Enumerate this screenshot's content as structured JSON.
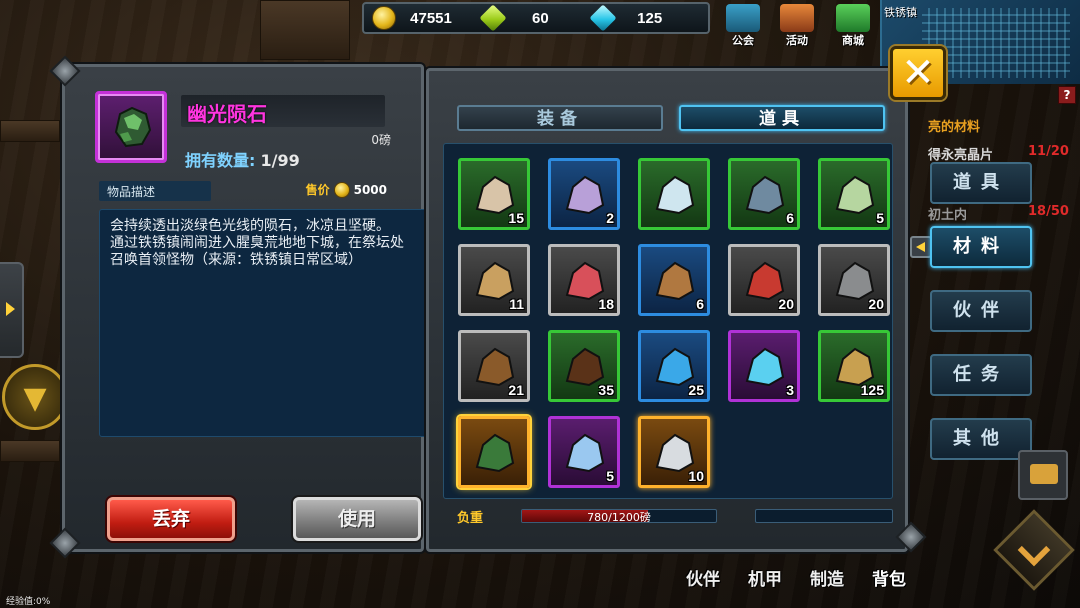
{
  "currency": [
    {
      "icon": "gold-coin-icon",
      "value": "47551"
    },
    {
      "icon": "green-gem-icon",
      "value": "60"
    },
    {
      "icon": "blue-diamond-icon",
      "value": "125"
    }
  ],
  "top_menu": [
    {
      "label": "公会",
      "icon": "guild-icon"
    },
    {
      "label": "活动",
      "icon": "event-icon"
    },
    {
      "label": "商城",
      "icon": "shop-cart-icon"
    }
  ],
  "minimap": {
    "title": "铁锈镇"
  },
  "help": "?",
  "quest_behind": {
    "line1": "亮的材料",
    "line2_left": "得永亮晶片",
    "line2_right": "11/20",
    "line3_left": "初土内",
    "line3_right": "18/50"
  },
  "detail": {
    "name": "幽光陨石",
    "weight": "0磅",
    "owned_label": "拥有数量:",
    "owned_value": "1/99",
    "desc_label": "物品描述",
    "price_label": "售价",
    "price_value": "5000",
    "description": "会持续透出淡绿色光线的陨石，冰凉且坚硬。\n通过铁锈镇闹闹进入腥臭荒地地下城，在祭坛处召唤首领怪物（来源：铁锈镇日常区域）",
    "discard_label": "丢弃",
    "use_label": "使用"
  },
  "tabs": {
    "equip": "装备",
    "items": "道具",
    "active": "items"
  },
  "inventory": [
    {
      "name": "sand-pile",
      "rarity": "green",
      "count": "15",
      "color": "#d8c4a8"
    },
    {
      "name": "purple-powder",
      "rarity": "blue",
      "count": "2",
      "color": "#b8a0d8"
    },
    {
      "name": "test-tube",
      "rarity": "green",
      "count": "",
      "color": "#cfe6ef"
    },
    {
      "name": "iron-clamp",
      "rarity": "green",
      "count": "6",
      "color": "#6f8aa0"
    },
    {
      "name": "green-powder",
      "rarity": "green",
      "count": "5",
      "color": "#b6d6a0"
    },
    {
      "name": "potato",
      "rarity": "white",
      "count": "11",
      "color": "#c9a060"
    },
    {
      "name": "raw-meat",
      "rarity": "white",
      "count": "18",
      "color": "#d8505a"
    },
    {
      "name": "mushrooms",
      "rarity": "blue",
      "count": "6",
      "color": "#b07840"
    },
    {
      "name": "red-fang",
      "rarity": "white",
      "count": "20",
      "color": "#c83a30"
    },
    {
      "name": "iron-scrap",
      "rarity": "white",
      "count": "20",
      "color": "#8a8c8e"
    },
    {
      "name": "leather-hide",
      "rarity": "white",
      "count": "21",
      "color": "#8a5a2a"
    },
    {
      "name": "chocolate-cube",
      "rarity": "green",
      "count": "35",
      "color": "#5a3218"
    },
    {
      "name": "blue-crystal-cube",
      "rarity": "blue",
      "count": "25",
      "color": "#3aa8e8"
    },
    {
      "name": "energy-capsule",
      "rarity": "purple",
      "count": "3",
      "color": "#5ad0f0"
    },
    {
      "name": "fuel-canister",
      "rarity": "green",
      "count": "125",
      "color": "#c8a050"
    },
    {
      "name": "glow-meteorite",
      "rarity": "orange",
      "count": "",
      "color": "#3a7a3a",
      "selected": true
    },
    {
      "name": "prism-gem",
      "rarity": "purple",
      "count": "5",
      "color": "#9ac8f0"
    },
    {
      "name": "silver-ingot",
      "rarity": "orange",
      "count": "10",
      "color": "#d8dce0"
    }
  ],
  "load": {
    "label": "负重",
    "current": 780,
    "max": 1200,
    "text": "780/1200磅"
  },
  "categories": [
    {
      "label": "道具",
      "active": false
    },
    {
      "label": "材料",
      "active": true
    },
    {
      "label": "伙伴",
      "active": false
    },
    {
      "label": "任务",
      "active": false
    },
    {
      "label": "其他",
      "active": false
    }
  ],
  "bottom_nav": [
    "伙伴",
    "机甲",
    "制造",
    "背包"
  ],
  "exp_text": "经验值:0%"
}
